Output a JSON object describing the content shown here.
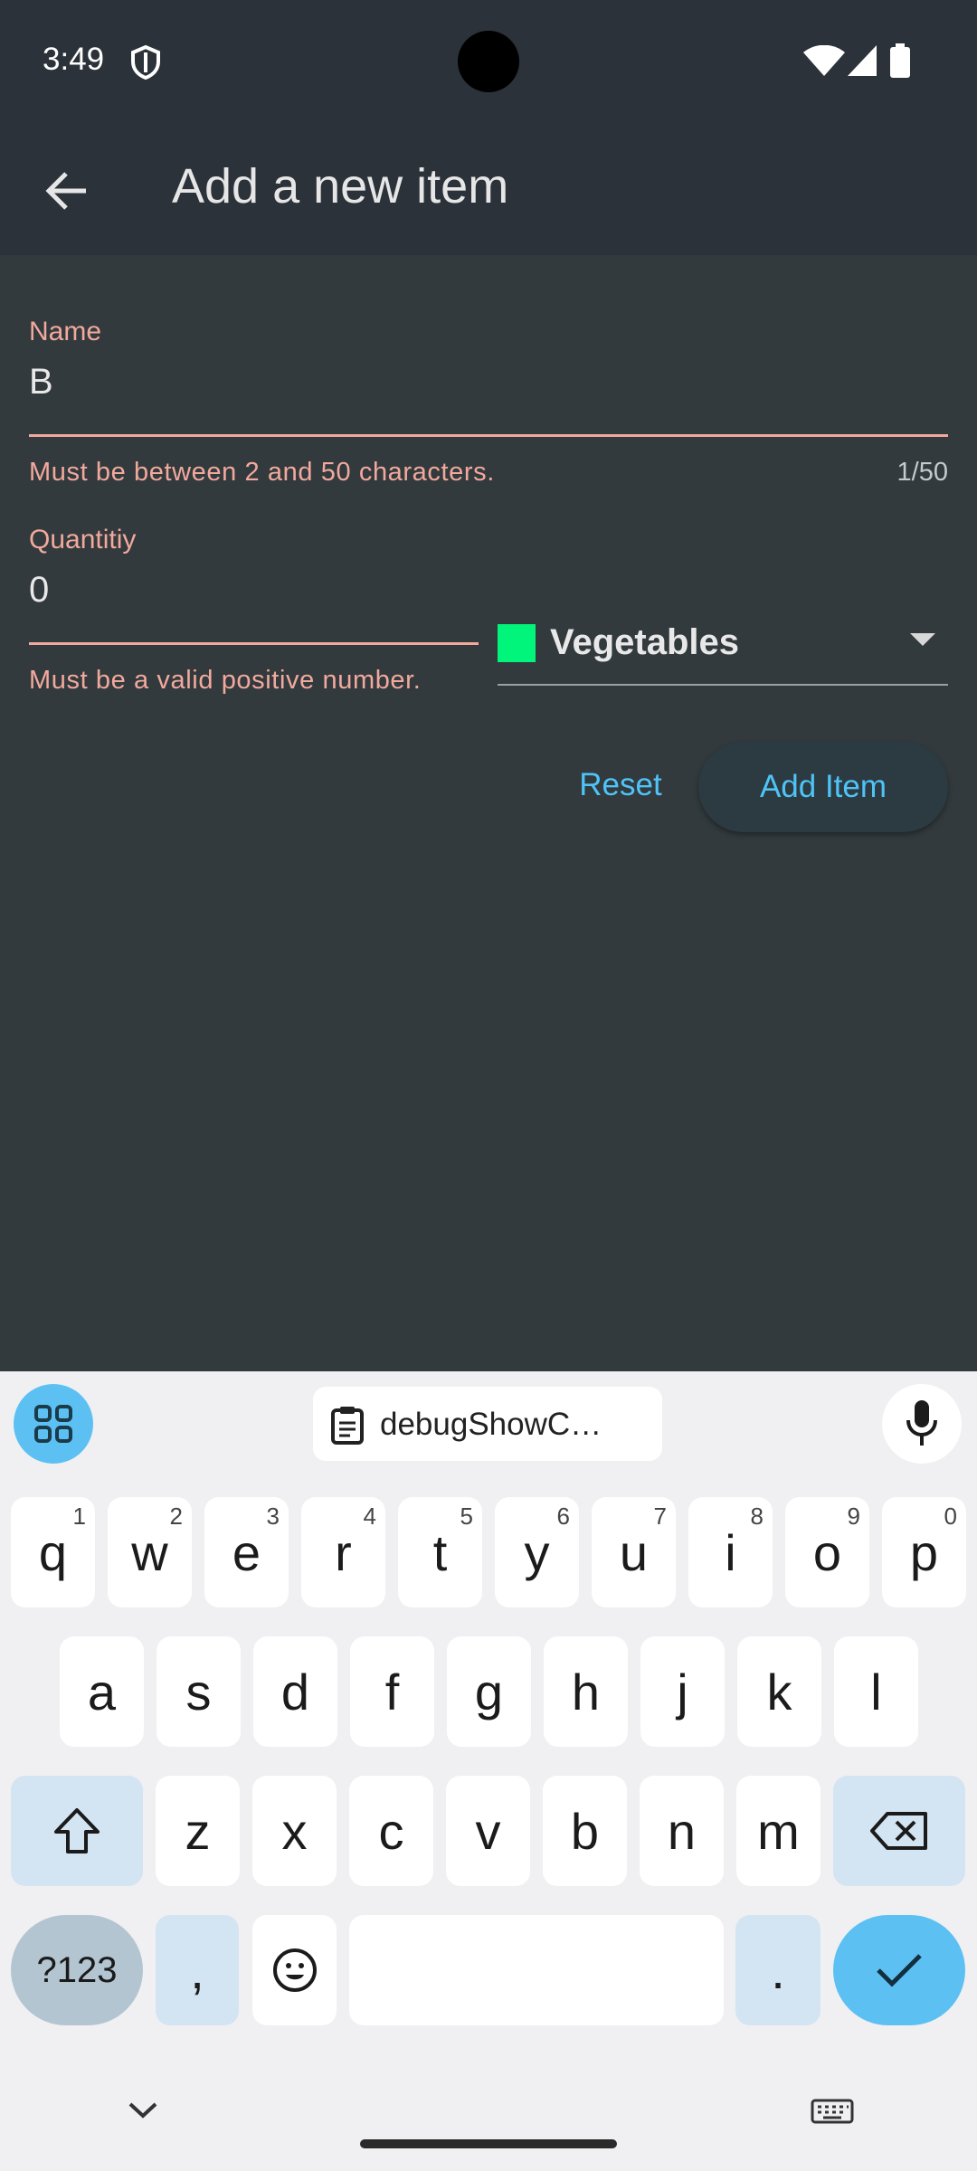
{
  "status_bar": {
    "time": "3:49"
  },
  "app_bar": {
    "title": "Add a new item"
  },
  "form": {
    "name_label": "Name",
    "name_value": "B",
    "name_error": "Must be between 2 and 50 characters.",
    "name_counter": "1/50",
    "quantity_label": "Quantitiy",
    "quantity_value": "0",
    "quantity_error": "Must be a valid positive number.",
    "category": {
      "label": "Vegetables",
      "color": "#00f57a"
    },
    "reset_label": "Reset",
    "add_label": "Add Item"
  },
  "keyboard": {
    "clipboard_chip": "debugShowC…",
    "row1": [
      {
        "key": "q",
        "hint": "1"
      },
      {
        "key": "w",
        "hint": "2"
      },
      {
        "key": "e",
        "hint": "3"
      },
      {
        "key": "r",
        "hint": "4"
      },
      {
        "key": "t",
        "hint": "5"
      },
      {
        "key": "y",
        "hint": "6"
      },
      {
        "key": "u",
        "hint": "7"
      },
      {
        "key": "i",
        "hint": "8"
      },
      {
        "key": "o",
        "hint": "9"
      },
      {
        "key": "p",
        "hint": "0"
      }
    ],
    "row2": [
      "a",
      "s",
      "d",
      "f",
      "g",
      "h",
      "j",
      "k",
      "l"
    ],
    "row3": [
      "z",
      "x",
      "c",
      "v",
      "b",
      "n",
      "m"
    ],
    "symbols_label": "?123",
    "comma": ",",
    "period": "."
  },
  "colors": {
    "accent": "#4fc3f7",
    "error": "#f2a99d",
    "background": "#323a3d",
    "app_bar": "#2c3239"
  }
}
